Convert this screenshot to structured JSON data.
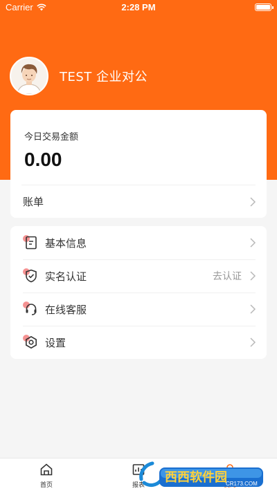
{
  "status_bar": {
    "carrier": "Carrier",
    "time": "2:28 PM"
  },
  "profile": {
    "company_name": "TEST 企业对公"
  },
  "balance": {
    "label": "今日交易金额",
    "amount": "0.00",
    "bill_label": "账单"
  },
  "menu": {
    "items": [
      {
        "label": "基本信息",
        "icon": "info-doc-icon",
        "extra": ""
      },
      {
        "label": "实名认证",
        "icon": "shield-check-icon",
        "extra": "去认证"
      },
      {
        "label": "在线客服",
        "icon": "headset-icon",
        "extra": ""
      },
      {
        "label": "设置",
        "icon": "settings-hex-icon",
        "extra": ""
      }
    ]
  },
  "tabbar": {
    "tabs": [
      {
        "label": "首页",
        "icon": "home-icon",
        "active": false
      },
      {
        "label": "报表",
        "icon": "report-icon",
        "active": false
      },
      {
        "label": "我的",
        "icon": "profile-icon",
        "active": true
      }
    ]
  },
  "watermark": {
    "brand": "西西软件园",
    "url": "CR173.COM"
  },
  "colors": {
    "accent": "#ff6a13",
    "icon_dot": "#f26d6d",
    "background": "#f5f5f5"
  }
}
